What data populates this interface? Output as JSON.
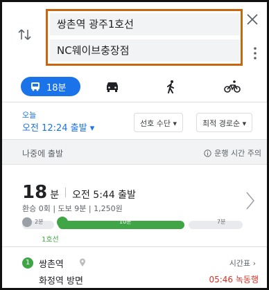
{
  "search": {
    "from": "쌍촌역 광주1호선",
    "to": "NC웨이브충장점"
  },
  "modes": {
    "transit_label": "18분",
    "active": "transit"
  },
  "options": {
    "today": "오늘",
    "time": "오전 12:24 출발 ▾",
    "mode_pref": "선호 수단 ▾",
    "sort": "최적 경로순 ▾"
  },
  "later_bar": {
    "later": "나중에 출발",
    "notice": "운행 시간 주의"
  },
  "route": {
    "duration_num": "18",
    "duration_unit": "분",
    "depart": "오전 5:44 출발",
    "detail": "환승 0회 | 도보 9분 | 1,250원",
    "walk1": "2분",
    "bus": "10분",
    "walk2": "7분",
    "line": "1호선"
  },
  "stop": {
    "badge": "1",
    "name": "쌍촌역",
    "timetable": "시간표 ›",
    "direction": "화정역 방면",
    "next_time": "05:46 녹동행"
  },
  "colors": {
    "accent": "#1a73e8",
    "highlight_border": "#c8650f",
    "line_green": "#3fa547",
    "alert_red": "#d93025"
  }
}
